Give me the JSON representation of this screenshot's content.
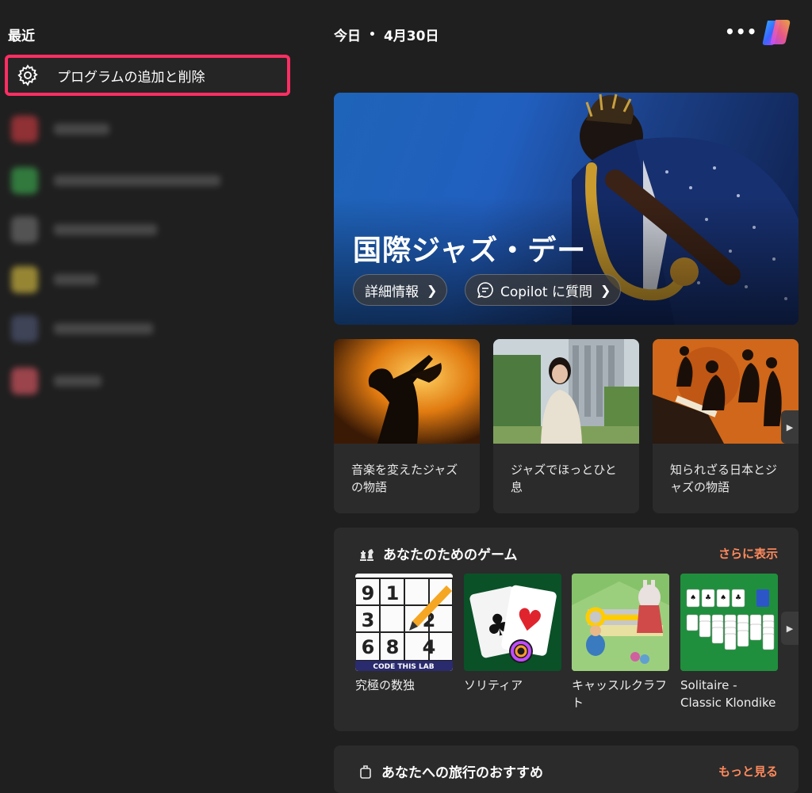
{
  "left": {
    "heading": "最近",
    "highlighted_item": {
      "label": "プログラムの追加と削除",
      "icon": "gear-icon"
    }
  },
  "header": {
    "today_label": "今日",
    "date": "4月30日",
    "more_icon": "more-icon",
    "more_glyph": "•••",
    "copilot_icon": "copilot-icon"
  },
  "hero": {
    "title": "国際ジャズ・デー",
    "details_button": "詳細情報",
    "copilot_button": "Copilot に質問"
  },
  "stories": [
    {
      "caption": "音楽を変えたジャズの物語"
    },
    {
      "caption": "ジャズでほっとひと息"
    },
    {
      "caption": "知られざる日本とジャズの物語"
    }
  ],
  "games": {
    "title": "あなたのためのゲーム",
    "more_label": "さらに表示",
    "items": [
      {
        "name": "究極の数独",
        "tile_text": [
          "9",
          "1",
          "3",
          "2",
          "6",
          "8",
          "4"
        ],
        "brand": "CODE THIS LAB"
      },
      {
        "name": "ソリティア"
      },
      {
        "name": "キャッスルクラフト"
      },
      {
        "name": "Solitaire - Classic Klondike"
      }
    ]
  },
  "travel": {
    "title": "あなたへの旅行のおすすめ",
    "more_label": "もっと見る"
  },
  "colors": {
    "background": "#1f1f1f",
    "card": "#2b2b2b",
    "highlight_border": "#ff2e63",
    "accent_link": "#ff8a5c"
  }
}
